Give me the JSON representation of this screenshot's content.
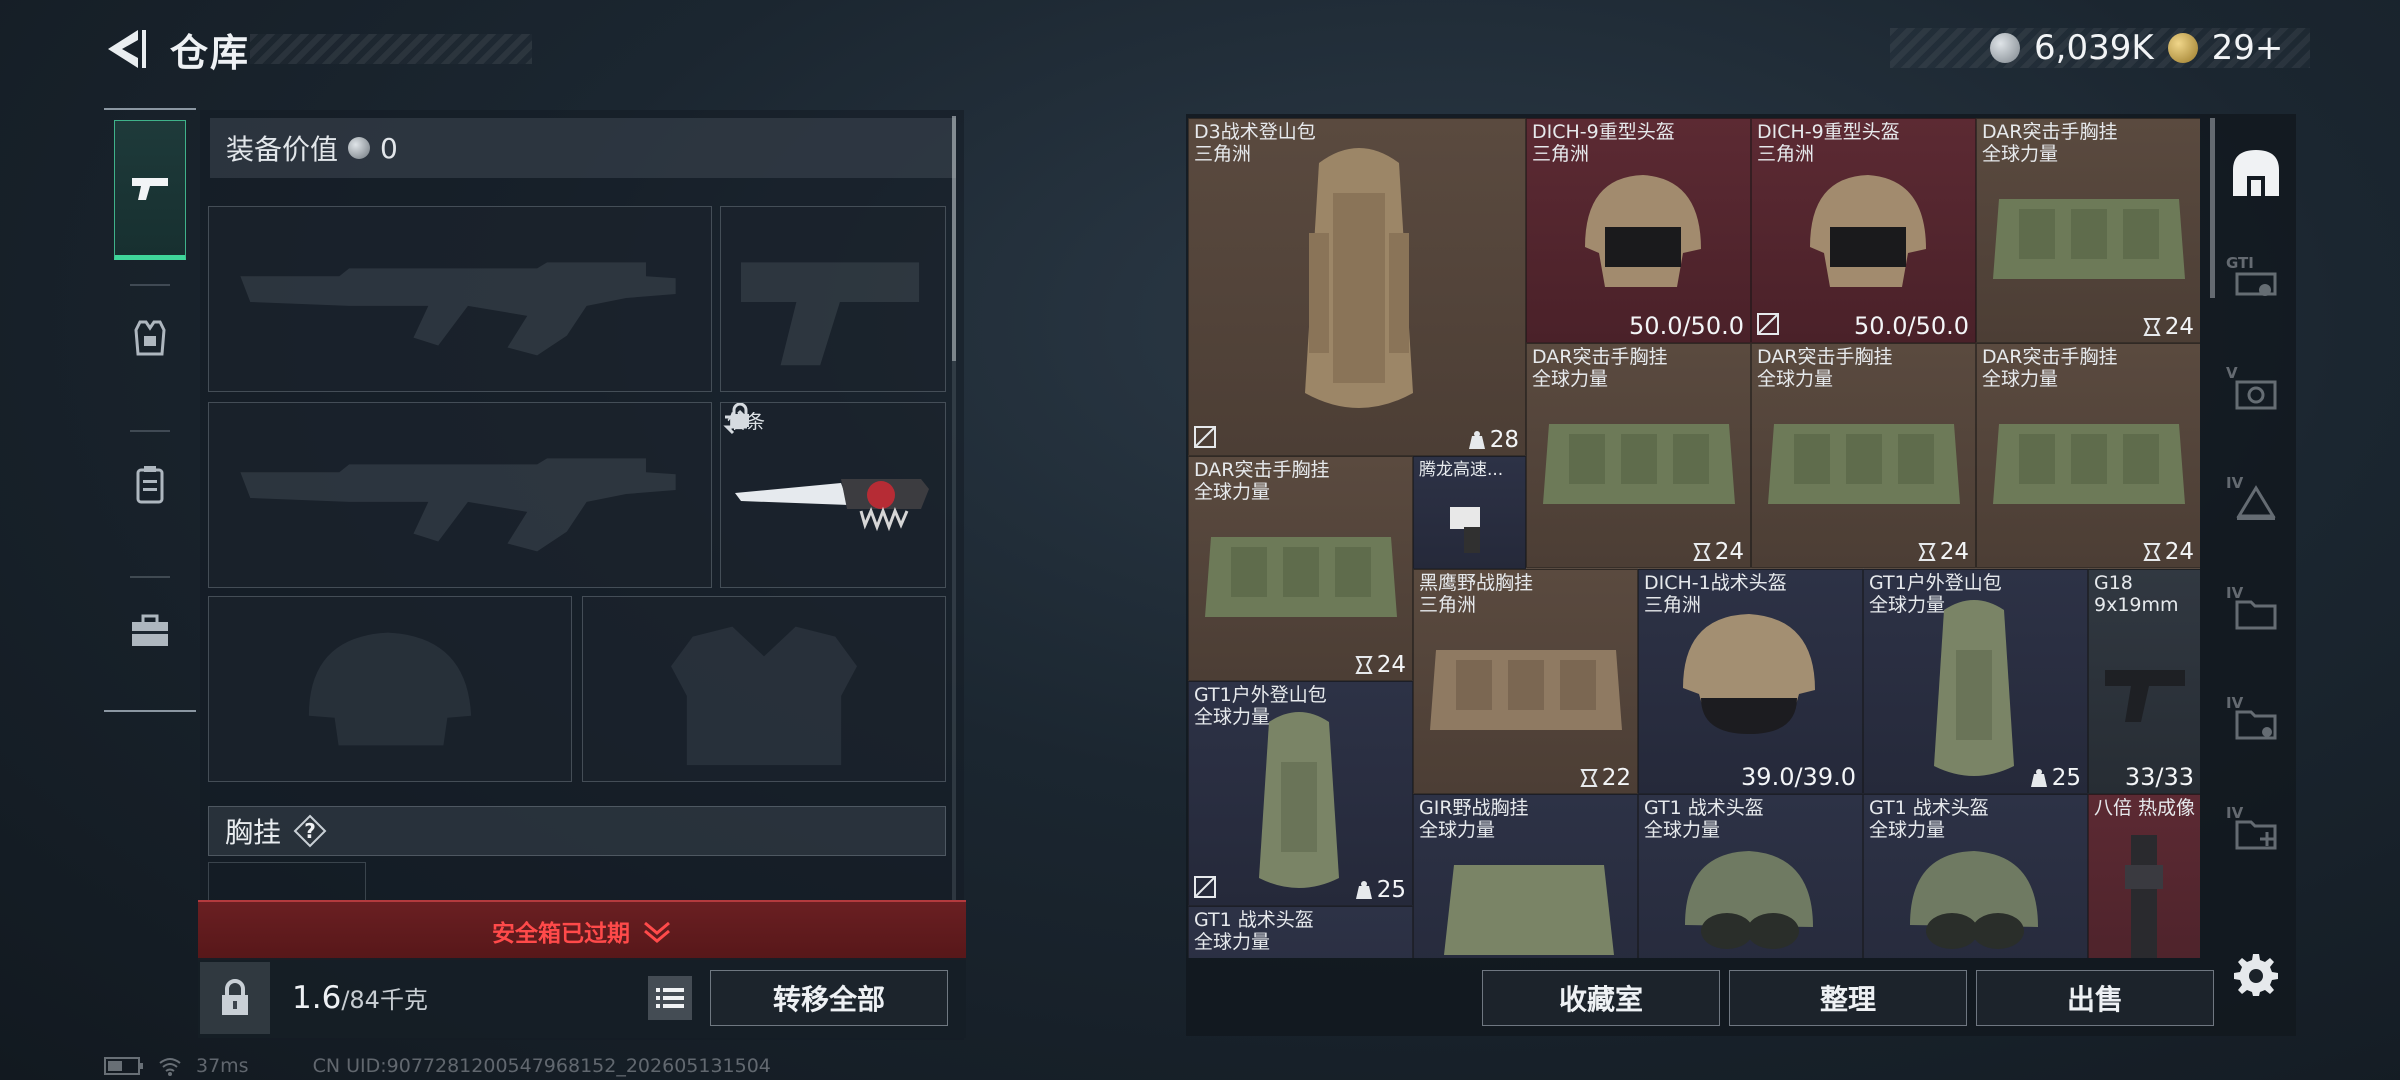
{
  "header": {
    "title": "仓库",
    "currency_silver": "6,039K",
    "currency_gold": "29+"
  },
  "loadout": {
    "value_label": "装备价值",
    "value": "0",
    "card_slot_label": "信条",
    "vest_label": "胸挂",
    "vest_help": "?",
    "expired_text": "安全箱已过期",
    "weight_current": "1.6",
    "weight_capacity": "/84千克",
    "transfer_all": "转移全部"
  },
  "storage": {
    "items": [
      {
        "name": "D3战术登山包",
        "sub": "三角洲",
        "qty": "28"
      },
      {
        "name": "DICH-9重型头盔",
        "sub": "三角洲",
        "value": "50.0/50.0"
      },
      {
        "name": "DICH-9重型头盔",
        "sub": "三角洲",
        "value": "50.0/50.0"
      },
      {
        "name": "DAR突击手胸挂",
        "sub": "全球力量",
        "qty": "24"
      },
      {
        "name": "DAR突击手胸挂",
        "sub": "全球力量",
        "qty": "24"
      },
      {
        "name": "DAR突击手胸挂",
        "sub": "全球力量",
        "qty": "24"
      },
      {
        "name": "DAR突击手胸挂",
        "sub": "全球力量",
        "qty": "24"
      },
      {
        "name": "DAR突击手胸挂",
        "sub": "全球力量",
        "qty": "24"
      },
      {
        "name": "腾龙高速...",
        "sub": ""
      },
      {
        "name": "黑鹰野战胸挂",
        "sub": "三角洲",
        "qty": "22"
      },
      {
        "name": "DICH-1战术头盔",
        "sub": "三角洲",
        "value": "39.0/39.0"
      },
      {
        "name": "GT1户外登山包",
        "sub": "全球力量",
        "qty": "25"
      },
      {
        "name": "G18",
        "sub": "9x19mm",
        "value": "33/33"
      },
      {
        "name": "GT1户外登山包",
        "sub": "全球力量",
        "qty": "25"
      },
      {
        "name": "GIR野战胸挂",
        "sub": "全球力量"
      },
      {
        "name": "GT1 战术头盔",
        "sub": "全球力量"
      },
      {
        "name": "GT1 战术头盔",
        "sub": "全球力量"
      },
      {
        "name": "八倍 热成像",
        "sub": ""
      },
      {
        "name": "GT1 战术头盔",
        "sub": "全球力量"
      }
    ],
    "right_tabs": [
      "GTI",
      "V",
      "IV",
      "IV",
      "IV",
      "IV"
    ]
  },
  "actions": {
    "collection": "收藏室",
    "organize": "整理",
    "sell": "出售"
  },
  "status": {
    "ping": "37ms",
    "uid": "CN UID:9077281200547968152_202605131504"
  },
  "colors": {
    "accent_green": "#3fd69a",
    "expired_red": "#ff4a4a",
    "tile_brown": "#5a4a3f",
    "tile_red": "#5c2a33",
    "tile_blue": "#2d3246"
  }
}
